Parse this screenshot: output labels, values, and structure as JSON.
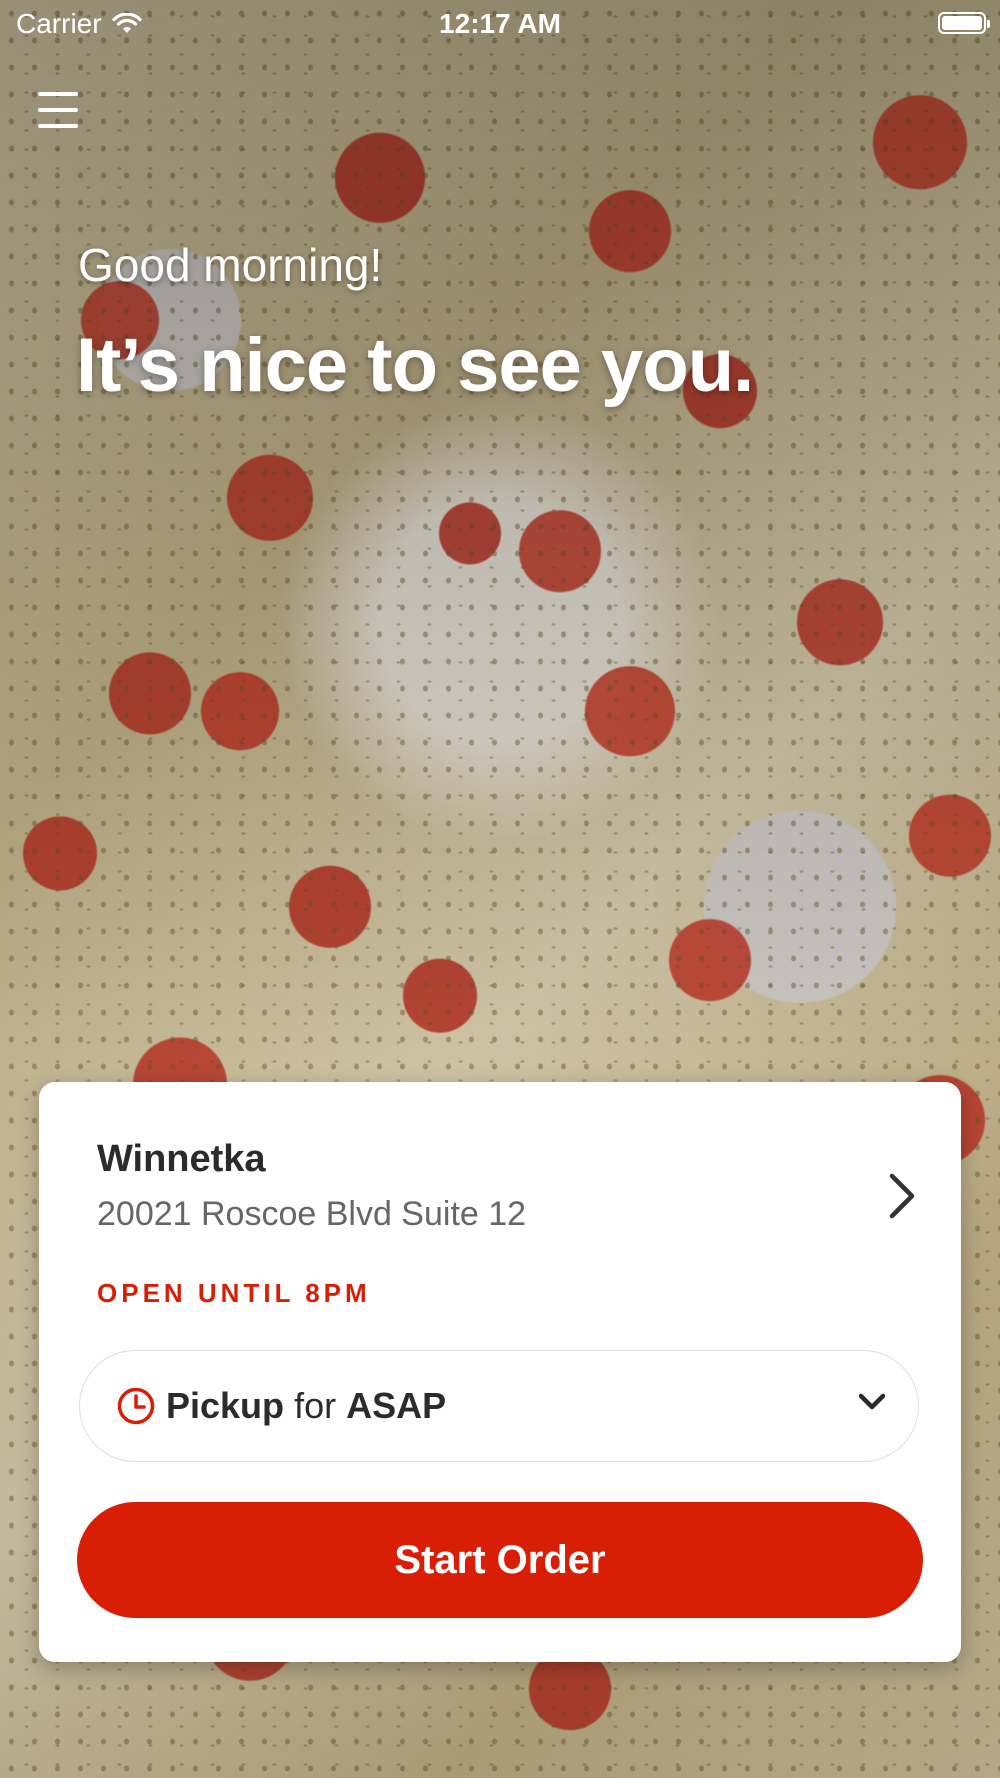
{
  "status_bar": {
    "carrier": "Carrier",
    "time": "12:17 AM"
  },
  "hero": {
    "greeting": "Good morning!",
    "headline": "It’s nice to see you."
  },
  "location": {
    "name": "Winnetka",
    "address": "20021 Roscoe Blvd Suite 12",
    "hours": "OPEN UNTIL 8PM"
  },
  "order_mode": {
    "mode": "Pickup",
    "connector": "for",
    "time": "ASAP"
  },
  "cta": {
    "label": "Start Order"
  },
  "colors": {
    "accent": "#d81e05",
    "card": "#ffffff"
  },
  "icons": [
    "wifi-icon",
    "battery-icon",
    "hamburger-menu-icon",
    "chevron-right-icon",
    "clock-icon",
    "chevron-down-icon"
  ]
}
